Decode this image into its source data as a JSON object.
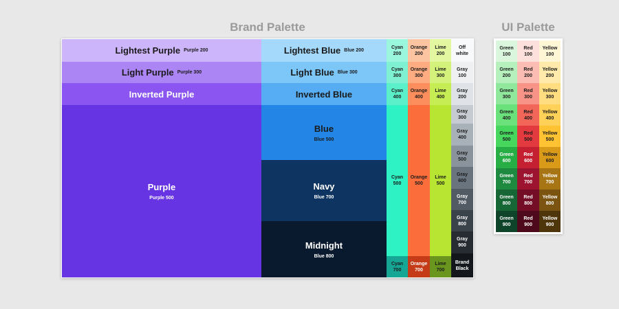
{
  "brand_title": "Brand Palette",
  "ui_title": "UI Palette",
  "purple": [
    {
      "name": "Lightest Purple",
      "sub": "Purple 200",
      "color": "#cdb5fb"
    },
    {
      "name": "Light Purple",
      "sub": "Purple 300",
      "color": "#ac85f5"
    },
    {
      "name": "Inverted Purple",
      "sub": "",
      "color": "#8a55f0"
    },
    {
      "name": "Purple",
      "sub": "Purple 500",
      "color": "#6634e2"
    }
  ],
  "blue": [
    {
      "name": "Lightest Blue",
      "sub": "Blue 200",
      "color": "#a4d9fc"
    },
    {
      "name": "Light Blue",
      "sub": "Blue 300",
      "color": "#7cc6f8"
    },
    {
      "name": "Inverted Blue",
      "sub": "",
      "color": "#56adf3"
    },
    {
      "name": "Blue",
      "sub": "Blue 500",
      "color": "#2385e6"
    },
    {
      "name": "Navy",
      "sub": "Blue 700",
      "color": "#0e3461"
    },
    {
      "name": "Midnight",
      "sub": "Blue 800",
      "color": "#0a1a2e"
    }
  ],
  "cyan": [
    {
      "l1": "Cyan",
      "l2": "200",
      "color": "#9af6dd"
    },
    {
      "l1": "Cyan",
      "l2": "300",
      "color": "#7ff0d1"
    },
    {
      "l1": "Cyan",
      "l2": "400",
      "color": "#5bf0c9"
    },
    {
      "l1": "Cyan",
      "l2": "500",
      "color": "#2ef2c4"
    },
    {
      "l1": "Cyan",
      "l2": "700",
      "color": "#15a696"
    }
  ],
  "orange": [
    {
      "l1": "Orange",
      "l2": "200",
      "color": "#fdc4a2"
    },
    {
      "l1": "Orange",
      "l2": "300",
      "color": "#fdab81"
    },
    {
      "l1": "Orange",
      "l2": "400",
      "color": "#fb8e5c"
    },
    {
      "l1": "Orange",
      "l2": "500",
      "color": "#fb6e3c"
    },
    {
      "l1": "Orange",
      "l2": "700",
      "color": "#c53a17"
    }
  ],
  "lime": [
    {
      "l1": "Lime",
      "l2": "200",
      "color": "#e3f7a1"
    },
    {
      "l1": "Lime",
      "l2": "300",
      "color": "#d4f27b"
    },
    {
      "l1": "Lime",
      "l2": "400",
      "color": "#c6ee54"
    },
    {
      "l1": "Lime",
      "l2": "500",
      "color": "#b8e432"
    },
    {
      "l1": "Lime",
      "l2": "700",
      "color": "#6a951e"
    }
  ],
  "gray": [
    {
      "l1": "Off",
      "l2": "white",
      "color": "#f8f9fb"
    },
    {
      "l1": "Gray",
      "l2": "100",
      "color": "#eef0f2"
    },
    {
      "l1": "Gray",
      "l2": "200",
      "color": "#dfe3e7"
    },
    {
      "l1": "Gray",
      "l2": "300",
      "color": "#c5cbd1"
    },
    {
      "l1": "Gray",
      "l2": "400",
      "color": "#a8b0b8"
    },
    {
      "l1": "Gray",
      "l2": "500",
      "color": "#8a939c"
    },
    {
      "l1": "Gray",
      "l2": "600",
      "color": "#6a747e"
    },
    {
      "l1": "Gray",
      "l2": "700",
      "color": "#525b64"
    },
    {
      "l1": "Gray",
      "l2": "800",
      "color": "#3a424a"
    },
    {
      "l1": "Gray",
      "l2": "900",
      "color": "#262c32"
    },
    {
      "l1": "Brand",
      "l2": "Black",
      "color": "#14181c"
    }
  ],
  "ui": {
    "green": [
      {
        "l1": "Green",
        "l2": "100",
        "color": "#daf7dd"
      },
      {
        "l1": "Green",
        "l2": "200",
        "color": "#b5f0bd"
      },
      {
        "l1": "Green",
        "l2": "300",
        "color": "#90e89c"
      },
      {
        "l1": "Green",
        "l2": "400",
        "color": "#6be17c"
      },
      {
        "l1": "Green",
        "l2": "500",
        "color": "#47d65e"
      },
      {
        "l1": "Green",
        "l2": "600",
        "color": "#27ae45"
      },
      {
        "l1": "Green",
        "l2": "700",
        "color": "#1e8a3f"
      },
      {
        "l1": "Green",
        "l2": "800",
        "color": "#166636"
      },
      {
        "l1": "Green",
        "l2": "900",
        "color": "#0e4429"
      }
    ],
    "red": [
      {
        "l1": "Red",
        "l2": "100",
        "color": "#fde0dc"
      },
      {
        "l1": "Red",
        "l2": "200",
        "color": "#fbbcb3"
      },
      {
        "l1": "Red",
        "l2": "300",
        "color": "#f89487"
      },
      {
        "l1": "Red",
        "l2": "400",
        "color": "#f2665a"
      },
      {
        "l1": "Red",
        "l2": "500",
        "color": "#e23a3e"
      },
      {
        "l1": "Red",
        "l2": "600",
        "color": "#c42032"
      },
      {
        "l1": "Red",
        "l2": "700",
        "color": "#9c1430"
      },
      {
        "l1": "Red",
        "l2": "800",
        "color": "#740e27"
      },
      {
        "l1": "Red",
        "l2": "900",
        "color": "#4e0a1c"
      }
    ],
    "yellow": [
      {
        "l1": "Yellow",
        "l2": "100",
        "color": "#fff6d6"
      },
      {
        "l1": "Yellow",
        "l2": "200",
        "color": "#ffeaab"
      },
      {
        "l1": "Yellow",
        "l2": "300",
        "color": "#ffdd80"
      },
      {
        "l1": "Yellow",
        "l2": "400",
        "color": "#ffd159"
      },
      {
        "l1": "Yellow",
        "l2": "500",
        "color": "#fec232"
      },
      {
        "l1": "Yellow",
        "l2": "600",
        "color": "#d99a1a"
      },
      {
        "l1": "Yellow",
        "l2": "700",
        "color": "#a87515"
      },
      {
        "l1": "Yellow",
        "l2": "800",
        "color": "#7a5410"
      },
      {
        "l1": "Yellow",
        "l2": "900",
        "color": "#4e350a"
      }
    ]
  }
}
